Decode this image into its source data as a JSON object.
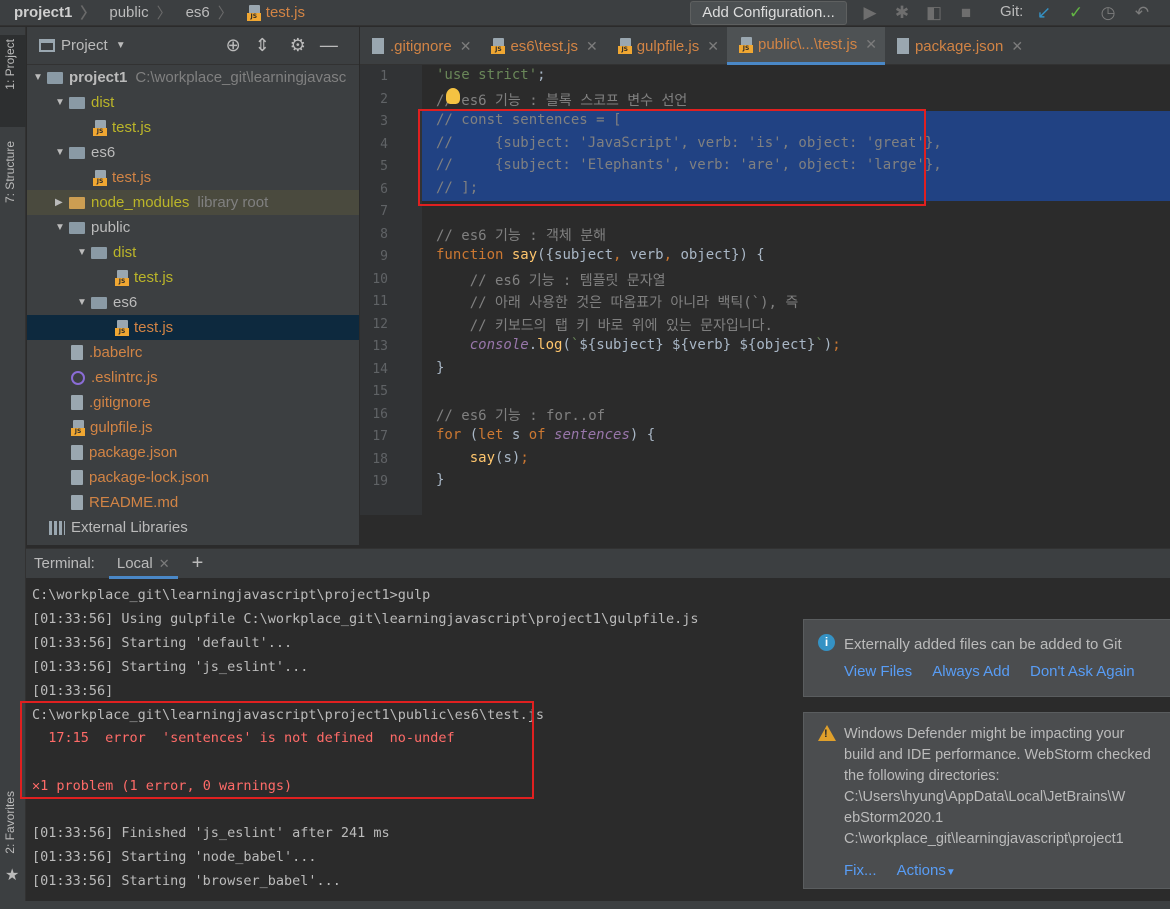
{
  "breadcrumb": [
    "project1",
    "public",
    "es6",
    "test.js"
  ],
  "toolbar": {
    "add_configuration": "Add Configuration...",
    "git_label": "Git:"
  },
  "tool_strip": {
    "project": "1: Project",
    "structure": "7: Structure",
    "favorites": "2: Favorites"
  },
  "project_panel": {
    "title": "Project",
    "tree": [
      {
        "label": "project1",
        "hint": "C:\\workplace_git\\learningjavasc",
        "type": "folder",
        "depth": 0
      },
      {
        "label": "dist",
        "type": "folder",
        "depth": 1
      },
      {
        "label": "test.js",
        "type": "js",
        "depth": 2
      },
      {
        "label": "es6",
        "type": "folder",
        "depth": 1
      },
      {
        "label": "test.js",
        "type": "js",
        "depth": 2
      },
      {
        "label": "node_modules",
        "hint": "library root",
        "type": "folder-mod",
        "depth": 1
      },
      {
        "label": "public",
        "type": "folder",
        "depth": 1
      },
      {
        "label": "dist",
        "type": "folder",
        "depth": 2
      },
      {
        "label": "test.js",
        "type": "js",
        "depth": 3
      },
      {
        "label": "es6",
        "type": "folder",
        "depth": 2
      },
      {
        "label": "test.js",
        "type": "js",
        "depth": 3
      },
      {
        "label": ".babelrc",
        "type": "file",
        "depth": 1
      },
      {
        "label": ".eslintrc.js",
        "type": "eslint",
        "depth": 1
      },
      {
        "label": ".gitignore",
        "type": "file",
        "depth": 1
      },
      {
        "label": "gulpfile.js",
        "type": "js",
        "depth": 1
      },
      {
        "label": "package.json",
        "type": "file",
        "depth": 1
      },
      {
        "label": "package-lock.json",
        "type": "file",
        "depth": 1
      },
      {
        "label": "README.md",
        "type": "md",
        "depth": 1
      },
      {
        "label": "External Libraries",
        "type": "lib",
        "depth": 0
      }
    ]
  },
  "tabs": [
    ".gitignore",
    "es6\\test.js",
    "gulpfile.js",
    "public\\...\\test.js",
    "package.json"
  ],
  "editor": {
    "line_numbers": [
      "1",
      "2",
      "3",
      "4",
      "5",
      "6",
      "7",
      "8",
      "9",
      "10",
      "11",
      "12",
      "13",
      "14",
      "15",
      "16",
      "17",
      "18",
      "19"
    ]
  },
  "terminal": {
    "title": "Terminal:",
    "tab": "Local",
    "lines": [
      "C:\\workplace_git\\learningjavascript\\project1>gulp",
      "[01:33:56] Using gulpfile C:\\workplace_git\\learningjavascript\\project1\\gulpfile.js",
      "[01:33:56] Starting 'default'...",
      "[01:33:56] Starting 'js_eslint'...",
      "[01:33:56]",
      "C:\\workplace_git\\learningjavascript\\project1\\public\\es6\\test.js",
      "  17:15  error  'sentences' is not defined  no-undef",
      "",
      "1 problem (1 error, 0 warnings)",
      "",
      "[01:33:56] Finished 'js_eslint' after 241 ms",
      "[01:33:56] Starting 'node_babel'...",
      "[01:33:56] Starting 'browser_babel'..."
    ]
  },
  "notifications": {
    "git": {
      "message": "Externally added files can be added to Git",
      "actions": [
        "View Files",
        "Always Add",
        "Don't Ask Again"
      ]
    },
    "defender": {
      "lines": [
        "Windows Defender might be impacting your",
        "build and IDE performance. WebStorm checked",
        "the following directories:",
        "C:\\Users\\hyung\\AppData\\Local\\JetBrains\\W",
        "ebStorm2020.1",
        "C:\\workplace_git\\learningjavascript\\project1"
      ],
      "actions": [
        "Fix...",
        "Actions"
      ]
    }
  }
}
